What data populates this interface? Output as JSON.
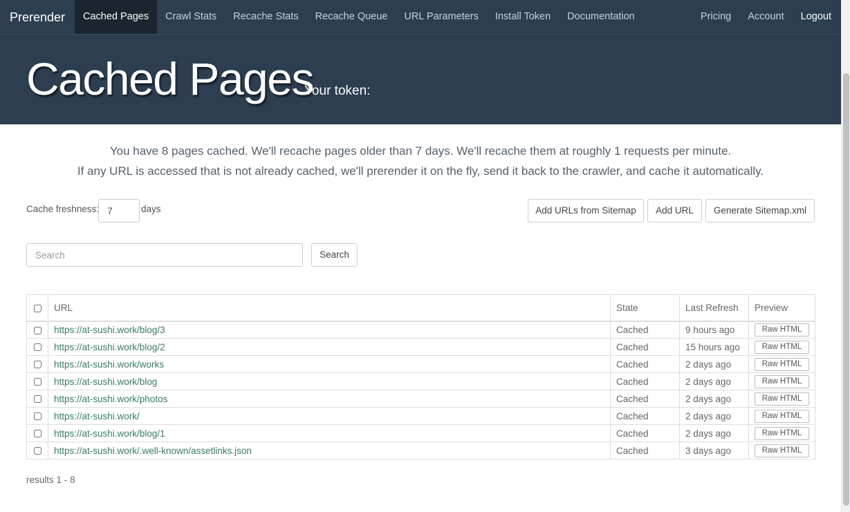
{
  "nav": {
    "brand": "Prerender",
    "left_items": [
      "Cached Pages",
      "Crawl Stats",
      "Recache Stats",
      "Recache Queue",
      "URL Parameters",
      "Install Token",
      "Documentation"
    ],
    "right_items": [
      "Pricing",
      "Account",
      "Logout"
    ]
  },
  "header": {
    "title": "Cached Pages",
    "token_label": "Your token:"
  },
  "intro": {
    "line1": "You have 8 pages cached. We'll recache pages older than 7 days. We'll recache them at roughly 1 requests per minute.",
    "line2": "If any URL is accessed that is not already cached, we'll prerender it on the fly, send it back to the crawler, and cache it automatically."
  },
  "controls": {
    "freshness_label": "Cache freshness:",
    "freshness_value": "7",
    "freshness_unit": "days",
    "add_sitemap_label": "Add URLs from Sitemap",
    "add_url_label": "Add URL",
    "generate_sitemap_label": "Generate Sitemap.xml",
    "search_placeholder": "Search",
    "search_button_label": "Search"
  },
  "table": {
    "headers": {
      "url": "URL",
      "state": "State",
      "last_refresh": "Last Refresh",
      "preview": "Preview"
    },
    "rows": [
      {
        "url": "https://at-sushi.work/blog/3",
        "state": "Cached",
        "last_refresh": "9 hours ago",
        "preview": "Raw HTML"
      },
      {
        "url": "https://at-sushi.work/blog/2",
        "state": "Cached",
        "last_refresh": "15 hours ago",
        "preview": "Raw HTML"
      },
      {
        "url": "https://at-sushi.work/works",
        "state": "Cached",
        "last_refresh": "2 days ago",
        "preview": "Raw HTML"
      },
      {
        "url": "https://at-sushi.work/blog",
        "state": "Cached",
        "last_refresh": "2 days ago",
        "preview": "Raw HTML"
      },
      {
        "url": "https://at-sushi.work/photos",
        "state": "Cached",
        "last_refresh": "2 days ago",
        "preview": "Raw HTML"
      },
      {
        "url": "https://at-sushi.work/",
        "state": "Cached",
        "last_refresh": "2 days ago",
        "preview": "Raw HTML"
      },
      {
        "url": "https://at-sushi.work/blog/1",
        "state": "Cached",
        "last_refresh": "2 days ago",
        "preview": "Raw HTML"
      },
      {
        "url": "https://at-sushi.work/.well-known/assetlinks.json",
        "state": "Cached",
        "last_refresh": "3 days ago",
        "preview": "Raw HTML"
      }
    ]
  },
  "results_text": "results 1 - 8",
  "colors": {
    "nav_bg": "#2c3e50",
    "nav_active_bg": "#1a252f",
    "link": "#3a7a6a"
  }
}
